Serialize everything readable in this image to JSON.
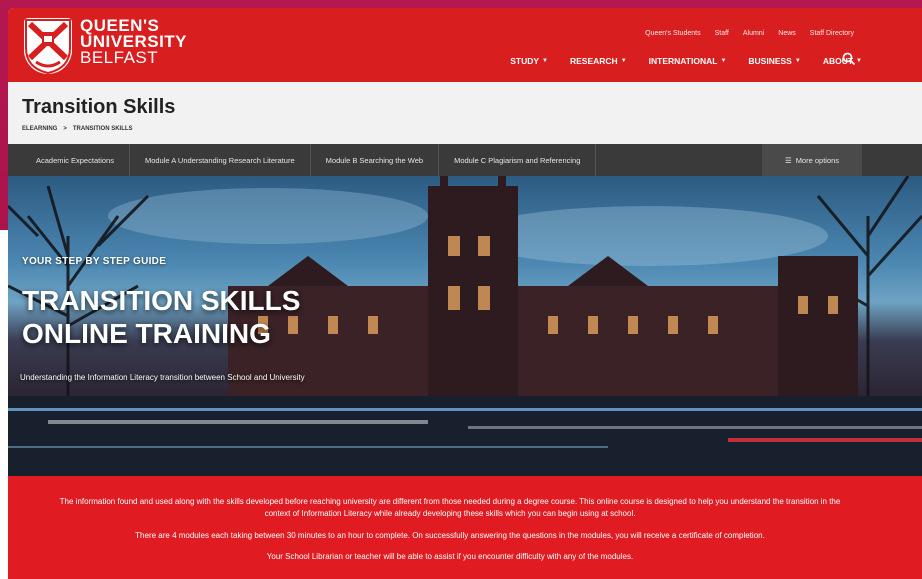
{
  "brand": {
    "line1": "QUEEN'S",
    "line2": "UNIVERSITY",
    "line3": "BELFAST"
  },
  "utility_nav": [
    "Queen's Students",
    "Staff",
    "Alumni",
    "News",
    "Staff Directory"
  ],
  "main_nav": [
    "STUDY",
    "RESEARCH",
    "INTERNATIONAL",
    "BUSINESS",
    "ABOUT"
  ],
  "page": {
    "title": "Transition Skills",
    "breadcrumb": [
      "ELEARNING",
      ">",
      "TRANSITION SKILLS"
    ]
  },
  "subnav": {
    "items": [
      "Academic Expectations",
      "Module A Understanding Research Literature",
      "Module B Searching the Web",
      "Module C Plagiarism and Referencing"
    ],
    "more": "More options"
  },
  "hero": {
    "kicker": "YOUR STEP BY STEP GUIDE",
    "title_line1": "TRANSITION SKILLS",
    "title_line2": "ONLINE TRAINING",
    "subtitle": "Understanding the Information Literacy transition between School and University"
  },
  "intro": {
    "p1": "The information found and used along with the skills developed before reaching university are different from those needed during a degree course. This online course is designed to help you understand the transition in the context of Information Literacy while already developing these skills which you can begin using at school.",
    "p2": "There are 4 modules each taking between 30 minutes to an hour to complete. On successfully answering the questions in the modules, you will receive a certificate of completion.",
    "p3": "Your School Librarian or teacher will be able to assist if you encounter difficulty with any of the modules."
  },
  "colors": {
    "brand_red": "#d81e1e",
    "intro_red": "#e11b22",
    "subnav_bg": "#3a3a3a",
    "backdrop": "#a31248"
  },
  "icons": [
    "crest-icon",
    "caret-down-icon",
    "search-icon",
    "menu-icon"
  ]
}
